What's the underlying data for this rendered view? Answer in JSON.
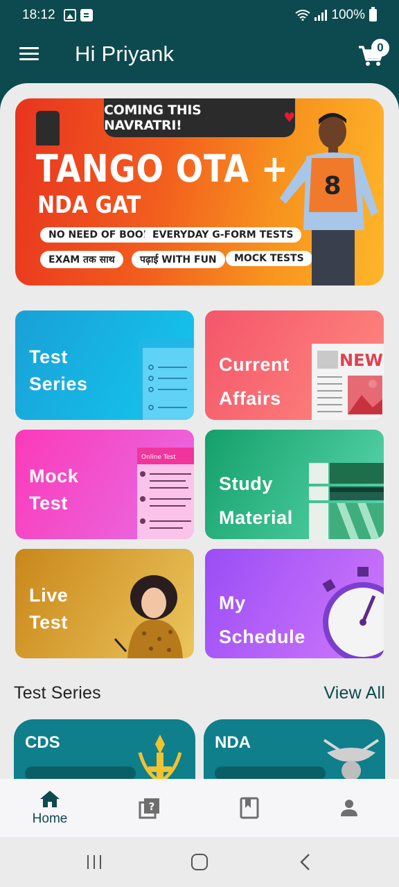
{
  "status_bar": {
    "time": "18:12",
    "battery": "100%"
  },
  "header": {
    "greeting": "Hi Priyank",
    "cart_count": "0"
  },
  "banner": {
    "tag": "COMING THIS NAVRATRI!",
    "title_line1": "TANGO OTA +",
    "title_line2": "NDA GAT",
    "pills": [
      "NO NEED OF BOOK",
      "EVERYDAY G-FORM TESTS",
      "EXAM तक साथ",
      "पढ़ाई WITH FUN",
      "MOCK TESTS"
    ],
    "bib_number": "8"
  },
  "categories": [
    {
      "line1": "Test",
      "line2": "Series"
    },
    {
      "line1": "Current",
      "line2": "Affairs",
      "badge": "NEW"
    },
    {
      "line1": "Mock",
      "line2": "Test",
      "sheet_header": "Online Test"
    },
    {
      "line1": "Study",
      "line2": "Material"
    },
    {
      "line1": "Live",
      "line2": "Test"
    },
    {
      "line1": "My",
      "line2": "Schedule"
    }
  ],
  "test_series_section": {
    "title": "Test Series",
    "view_all": "View All",
    "cards": [
      {
        "name": "CDS"
      },
      {
        "name": "NDA"
      }
    ]
  },
  "bottom_nav": [
    {
      "label": "Home",
      "icon": "home-icon",
      "active": true
    },
    {
      "label": "",
      "icon": "quiz-icon",
      "active": false
    },
    {
      "label": "",
      "icon": "bookmark-book-icon",
      "active": false
    },
    {
      "label": "",
      "icon": "profile-icon",
      "active": false
    }
  ],
  "colors": {
    "primary": "#0c4a4f",
    "background": "#ebebeb"
  }
}
